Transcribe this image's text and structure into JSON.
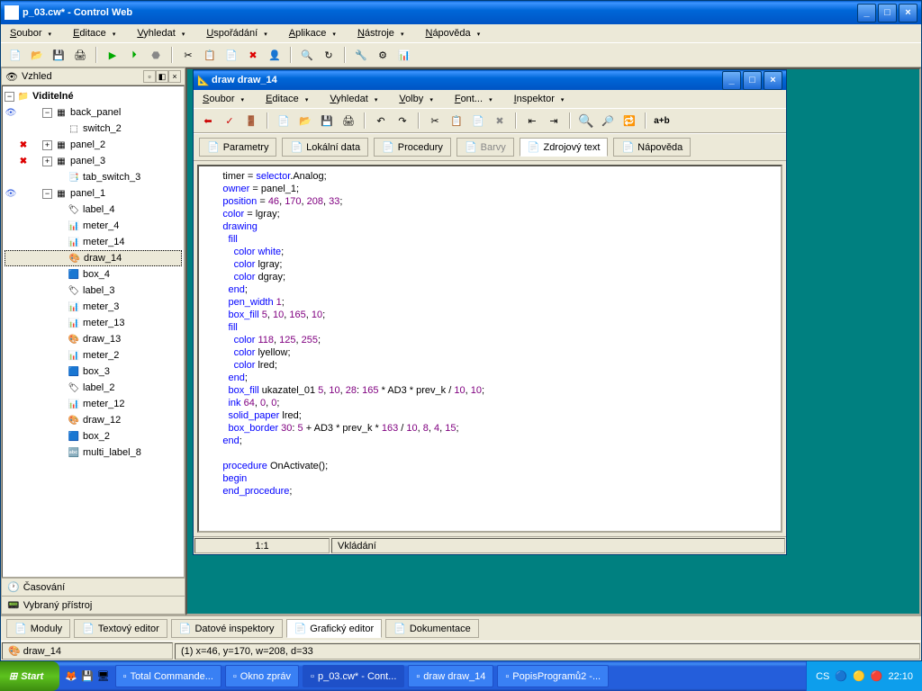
{
  "main_window": {
    "title": "p_03.cw* - Control Web",
    "menu": [
      "Soubor",
      "Editace",
      "Vyhledat",
      "Uspořádání",
      "Aplikace",
      "Nástroje",
      "Nápověda"
    ]
  },
  "left_panel": {
    "title": "Vzhled",
    "root": "Viditelné",
    "items": [
      {
        "level": 1,
        "icon": "panel",
        "label": "back_panel",
        "eye": true,
        "toggle": "-"
      },
      {
        "level": 2,
        "icon": "switch",
        "label": "switch_2"
      },
      {
        "level": 1,
        "icon": "panel",
        "label": "panel_2",
        "x": true,
        "toggle": "+"
      },
      {
        "level": 1,
        "icon": "panel",
        "label": "panel_3",
        "x": true,
        "toggle": "+"
      },
      {
        "level": 2,
        "icon": "tab",
        "label": "tab_switch_3"
      },
      {
        "level": 1,
        "icon": "panel",
        "label": "panel_1",
        "eye": true,
        "toggle": "-"
      },
      {
        "level": 2,
        "icon": "label",
        "label": "label_4"
      },
      {
        "level": 2,
        "icon": "meter",
        "label": "meter_4"
      },
      {
        "level": 2,
        "icon": "meter",
        "label": "meter_14"
      },
      {
        "level": 2,
        "icon": "draw",
        "label": "draw_14",
        "selected": true
      },
      {
        "level": 2,
        "icon": "box",
        "label": "box_4"
      },
      {
        "level": 2,
        "icon": "label",
        "label": "label_3"
      },
      {
        "level": 2,
        "icon": "meter",
        "label": "meter_3"
      },
      {
        "level": 2,
        "icon": "meter",
        "label": "meter_13"
      },
      {
        "level": 2,
        "icon": "draw",
        "label": "draw_13"
      },
      {
        "level": 2,
        "icon": "meter",
        "label": "meter_2"
      },
      {
        "level": 2,
        "icon": "box",
        "label": "box_3"
      },
      {
        "level": 2,
        "icon": "label",
        "label": "label_2"
      },
      {
        "level": 2,
        "icon": "meter",
        "label": "meter_12"
      },
      {
        "level": 2,
        "icon": "draw",
        "label": "draw_12"
      },
      {
        "level": 2,
        "icon": "box",
        "label": "box_2"
      },
      {
        "level": 2,
        "icon": "multi",
        "label": "multi_label_8"
      }
    ],
    "bottom1": "Časování",
    "bottom2": "Vybraný přístroj"
  },
  "child_window": {
    "title": "draw draw_14",
    "menu": [
      "Soubor",
      "Editace",
      "Vyhledat",
      "Volby",
      "Font...",
      "Inspektor"
    ],
    "tabs": [
      "Parametry",
      "Lokální data",
      "Procedury",
      "Barvy",
      "Zdrojový text",
      "Nápověda"
    ],
    "status_left": "1:1",
    "status_right": "Vkládání",
    "code": [
      {
        "indent": 3,
        "tokens": [
          [
            "ident",
            "timer"
          ],
          [
            "op",
            " = "
          ],
          [
            "kw",
            "selector"
          ],
          [
            "op",
            "."
          ],
          [
            "ident",
            "Analog"
          ],
          [
            "op",
            ";"
          ]
        ]
      },
      {
        "indent": 3,
        "tokens": [
          [
            "kw",
            "owner"
          ],
          [
            "op",
            " = "
          ],
          [
            "ident",
            "panel_1"
          ],
          [
            "op",
            ";"
          ]
        ]
      },
      {
        "indent": 3,
        "tokens": [
          [
            "kw",
            "position"
          ],
          [
            "op",
            " = "
          ],
          [
            "num",
            "46"
          ],
          [
            "op",
            ", "
          ],
          [
            "num",
            "170"
          ],
          [
            "op",
            ", "
          ],
          [
            "num",
            "208"
          ],
          [
            "op",
            ", "
          ],
          [
            "num",
            "33"
          ],
          [
            "op",
            ";"
          ]
        ]
      },
      {
        "indent": 3,
        "tokens": [
          [
            "kw",
            "color"
          ],
          [
            "op",
            " = "
          ],
          [
            "ident",
            "lgray"
          ],
          [
            "op",
            ";"
          ]
        ]
      },
      {
        "indent": 3,
        "tokens": [
          [
            "kw",
            "drawing"
          ]
        ]
      },
      {
        "indent": 4,
        "tokens": [
          [
            "kw",
            "fill"
          ]
        ]
      },
      {
        "indent": 5,
        "tokens": [
          [
            "kw",
            "color"
          ],
          [
            "op",
            " "
          ],
          [
            "kw",
            "white"
          ],
          [
            "op",
            ";"
          ]
        ]
      },
      {
        "indent": 5,
        "tokens": [
          [
            "kw",
            "color"
          ],
          [
            "op",
            " "
          ],
          [
            "ident",
            "lgray"
          ],
          [
            "op",
            ";"
          ]
        ]
      },
      {
        "indent": 5,
        "tokens": [
          [
            "kw",
            "color"
          ],
          [
            "op",
            " "
          ],
          [
            "ident",
            "dgray"
          ],
          [
            "op",
            ";"
          ]
        ]
      },
      {
        "indent": 4,
        "tokens": [
          [
            "kw",
            "end"
          ],
          [
            "op",
            ";"
          ]
        ]
      },
      {
        "indent": 4,
        "tokens": [
          [
            "kw",
            "pen_width"
          ],
          [
            "op",
            " "
          ],
          [
            "num",
            "1"
          ],
          [
            "op",
            ";"
          ]
        ]
      },
      {
        "indent": 4,
        "tokens": [
          [
            "kw",
            "box_fill"
          ],
          [
            "op",
            " "
          ],
          [
            "num",
            "5"
          ],
          [
            "op",
            ", "
          ],
          [
            "num",
            "10"
          ],
          [
            "op",
            ", "
          ],
          [
            "num",
            "165"
          ],
          [
            "op",
            ", "
          ],
          [
            "num",
            "10"
          ],
          [
            "op",
            ";"
          ]
        ]
      },
      {
        "indent": 4,
        "tokens": [
          [
            "kw",
            "fill"
          ]
        ]
      },
      {
        "indent": 5,
        "tokens": [
          [
            "kw",
            "color"
          ],
          [
            "op",
            " "
          ],
          [
            "num",
            "118"
          ],
          [
            "op",
            ", "
          ],
          [
            "num",
            "125"
          ],
          [
            "op",
            ", "
          ],
          [
            "num",
            "255"
          ],
          [
            "op",
            ";"
          ]
        ]
      },
      {
        "indent": 5,
        "tokens": [
          [
            "kw",
            "color"
          ],
          [
            "op",
            " "
          ],
          [
            "ident",
            "lyellow"
          ],
          [
            "op",
            ";"
          ]
        ]
      },
      {
        "indent": 5,
        "tokens": [
          [
            "kw",
            "color"
          ],
          [
            "op",
            " "
          ],
          [
            "ident",
            "lred"
          ],
          [
            "op",
            ";"
          ]
        ]
      },
      {
        "indent": 4,
        "tokens": [
          [
            "kw",
            "end"
          ],
          [
            "op",
            ";"
          ]
        ]
      },
      {
        "indent": 4,
        "tokens": [
          [
            "kw",
            "box_fill"
          ],
          [
            "op",
            " "
          ],
          [
            "ident",
            "ukazatel_01"
          ],
          [
            "op",
            " "
          ],
          [
            "num",
            "5"
          ],
          [
            "op",
            ", "
          ],
          [
            "num",
            "10"
          ],
          [
            "op",
            ", "
          ],
          [
            "num",
            "28"
          ],
          [
            "op",
            ": "
          ],
          [
            "num",
            "165"
          ],
          [
            "op",
            " * "
          ],
          [
            "ident",
            "AD3"
          ],
          [
            "op",
            " * "
          ],
          [
            "ident",
            "prev_k"
          ],
          [
            "op",
            " / "
          ],
          [
            "num",
            "10"
          ],
          [
            "op",
            ", "
          ],
          [
            "num",
            "10"
          ],
          [
            "op",
            ";"
          ]
        ]
      },
      {
        "indent": 4,
        "tokens": [
          [
            "kw",
            "ink"
          ],
          [
            "op",
            " "
          ],
          [
            "num",
            "64"
          ],
          [
            "op",
            ", "
          ],
          [
            "num",
            "0"
          ],
          [
            "op",
            ", "
          ],
          [
            "num",
            "0"
          ],
          [
            "op",
            ";"
          ]
        ]
      },
      {
        "indent": 4,
        "tokens": [
          [
            "kw",
            "solid_paper"
          ],
          [
            "op",
            " "
          ],
          [
            "ident",
            "lred"
          ],
          [
            "op",
            ";"
          ]
        ]
      },
      {
        "indent": 4,
        "tokens": [
          [
            "kw",
            "box_border"
          ],
          [
            "op",
            " "
          ],
          [
            "num",
            "30"
          ],
          [
            "op",
            ": "
          ],
          [
            "num",
            "5"
          ],
          [
            "op",
            " + "
          ],
          [
            "ident",
            "AD3"
          ],
          [
            "op",
            " * "
          ],
          [
            "ident",
            "prev_k"
          ],
          [
            "op",
            " * "
          ],
          [
            "num",
            "163"
          ],
          [
            "op",
            " / "
          ],
          [
            "num",
            "10"
          ],
          [
            "op",
            ", "
          ],
          [
            "num",
            "8"
          ],
          [
            "op",
            ", "
          ],
          [
            "num",
            "4"
          ],
          [
            "op",
            ", "
          ],
          [
            "num",
            "15"
          ],
          [
            "op",
            ";"
          ]
        ]
      },
      {
        "indent": 3,
        "tokens": [
          [
            "kw",
            "end"
          ],
          [
            "op",
            ";"
          ]
        ]
      },
      {
        "indent": 3,
        "tokens": [
          [
            "op",
            ""
          ]
        ]
      },
      {
        "indent": 3,
        "tokens": [
          [
            "kw",
            "procedure"
          ],
          [
            "op",
            " "
          ],
          [
            "ident",
            "OnActivate"
          ],
          [
            "op",
            "();"
          ]
        ]
      },
      {
        "indent": 3,
        "tokens": [
          [
            "kw",
            "begin"
          ]
        ]
      },
      {
        "indent": 3,
        "tokens": [
          [
            "kw",
            "end_procedure"
          ],
          [
            "op",
            ";"
          ]
        ]
      }
    ]
  },
  "bottom_tabs": [
    "Moduly",
    "Textový editor",
    "Datové inspektory",
    "Grafický editor",
    "Dokumentace"
  ],
  "status_main": {
    "left": "draw_14",
    "right": "(1) x=46, y=170, w=208, d=33"
  },
  "taskbar": {
    "start": "Start",
    "items": [
      "Total Commande...",
      "Okno zpráv",
      "p_03.cw* - Cont...",
      "draw draw_14",
      "PopisProgramů2 -..."
    ],
    "lang": "CS",
    "time": "22:10"
  }
}
